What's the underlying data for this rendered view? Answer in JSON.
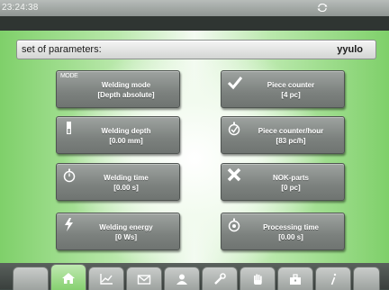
{
  "status_bar": {
    "time": "23:24:38",
    "sync_icon": "sync-icon"
  },
  "parameter_set": {
    "label": "set of parameters:",
    "value": "yyulo"
  },
  "tiles": {
    "welding_mode": {
      "title": "Welding mode",
      "value": "[Depth absolute]",
      "badge": "MODE"
    },
    "piece_counter": {
      "title": "Piece counter",
      "value": "[4 pc]",
      "icon": "checkmark-icon"
    },
    "welding_depth": {
      "title": "Welding depth",
      "value": "[0.00 mm]",
      "icon": "depth-gauge-icon"
    },
    "piece_counter_hour": {
      "title": "Piece counter/hour",
      "value": "[83 pc/h]",
      "icon": "stopwatch-check-icon"
    },
    "welding_time": {
      "title": "Welding time",
      "value": "[0.00 s]",
      "icon": "stopwatch-icon"
    },
    "nok_parts": {
      "title": "NOK-parts",
      "value": "[0 pc]",
      "icon": "x-mark-icon"
    },
    "welding_energy": {
      "title": "Welding energy",
      "value": "[0 Ws]",
      "icon": "lightning-icon"
    },
    "processing_time": {
      "title": "Processing time",
      "value": "[0.00 s]",
      "icon": "stopwatch-gear-icon"
    }
  },
  "tabs": [
    {
      "name": "tab-blank-left",
      "icon": ""
    },
    {
      "name": "tab-home",
      "icon": "home-icon",
      "active": true
    },
    {
      "name": "tab-graph",
      "icon": "graph-icon"
    },
    {
      "name": "tab-messages",
      "icon": "envelope-icon"
    },
    {
      "name": "tab-users",
      "icon": "user-icon"
    },
    {
      "name": "tab-service",
      "icon": "wrench-icon"
    },
    {
      "name": "tab-manual",
      "icon": "hand-icon"
    },
    {
      "name": "tab-toolbox",
      "icon": "toolbox-icon"
    },
    {
      "name": "tab-info",
      "icon": "info-icon"
    },
    {
      "name": "tab-blank-right",
      "icon": ""
    }
  ],
  "colors": {
    "active_tab": "#86d070",
    "tile": "#7c817e",
    "background_green": "#7fd06a"
  }
}
